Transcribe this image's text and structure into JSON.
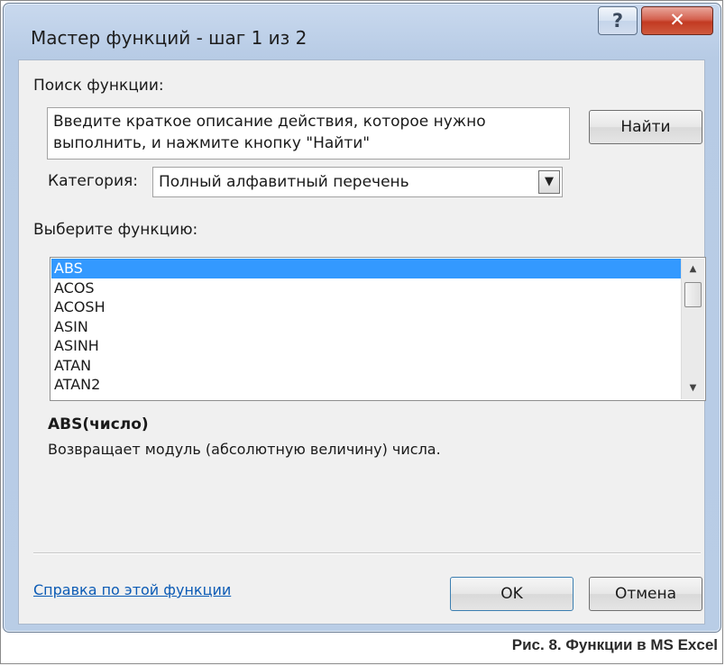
{
  "window": {
    "title": "Мастер функций - шаг 1 из 2",
    "help_glyph": "?",
    "close_glyph": "✕"
  },
  "search": {
    "label": "Поиск функции:",
    "placeholder": "Введите краткое описание действия, которое нужно выполнить, и нажмите кнопку \"Найти\"",
    "button": "Найти"
  },
  "category": {
    "label": "Категория:",
    "selected": "Полный алфавитный перечень",
    "arrow_glyph": "▼"
  },
  "functions": {
    "label": "Выберите функцию:",
    "items": [
      "ABS",
      "ACOS",
      "ACOSH",
      "ASIN",
      "ASINH",
      "ATAN",
      "ATAN2"
    ],
    "selected_index": 0,
    "scroll_up_glyph": "▲",
    "scroll_down_glyph": "▼"
  },
  "details": {
    "signature": "ABS(число)",
    "description": "Возвращает модуль (абсолютную величину) числа."
  },
  "footer": {
    "help_link": "Справка по этой функции",
    "ok": "OK",
    "cancel": "Отмена"
  },
  "caption": "Рис. 8. Функции в MS Excel",
  "colors": {
    "selection": "#3399ff",
    "link": "#0b5bb5",
    "close_button": "#c23a22"
  }
}
